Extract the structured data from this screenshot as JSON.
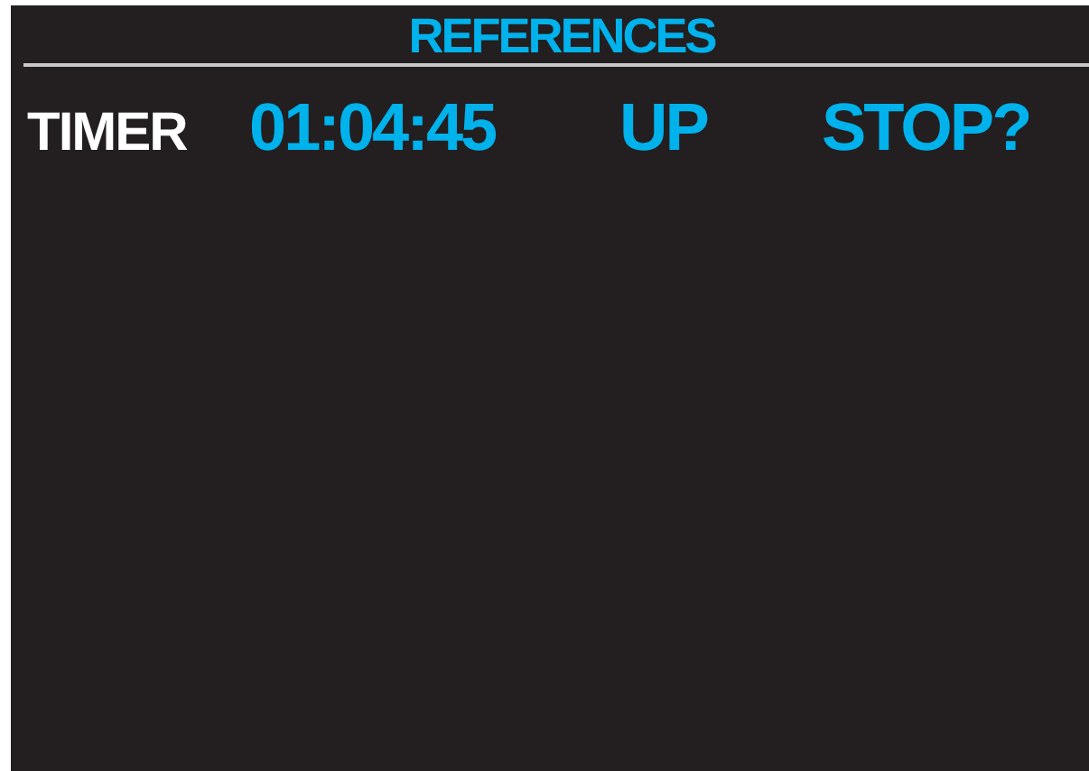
{
  "title": "REFERENCES",
  "timer": {
    "label": "TIMER",
    "time": "01:04:45",
    "direction": "UP",
    "action": "STOP?"
  }
}
